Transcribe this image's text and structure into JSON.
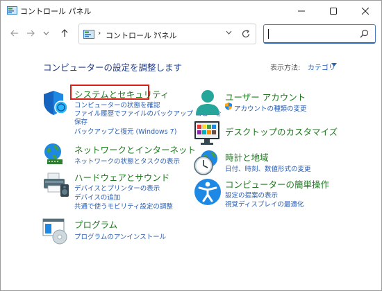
{
  "window": {
    "title": "コントロール パネル",
    "controls": {
      "minimize": "minimize-icon",
      "maximize": "maximize-icon",
      "close": "close-icon"
    }
  },
  "nav": {
    "back": "arrow-left-icon",
    "forward": "arrow-right-icon",
    "recent": "chevron-down-icon",
    "up": "arrow-up-icon",
    "address": {
      "separator": "›",
      "path": "コントロール パネル",
      "trailing_separator": "›"
    },
    "search": {
      "value": "",
      "icon": "search-icon"
    }
  },
  "header": {
    "title": "コンピューターの設定を調整します",
    "view_by_label": "表示方法:",
    "view_by_value": "カテゴリ"
  },
  "categories_left": [
    {
      "title": "システムとセキュリティ",
      "icon": "shield-icon",
      "highlighted": true,
      "links": [
        "コンピューターの状態を確認",
        "ファイル履歴でファイルのバックアップ コピーを",
        "保存",
        "バックアップと復元 (Windows 7)"
      ]
    },
    {
      "title": "ネットワークとインターネット",
      "icon": "network-globe-icon",
      "links": [
        "ネットワークの状態とタスクの表示"
      ]
    },
    {
      "title": "ハードウェアとサウンド",
      "icon": "printer-speaker-icon",
      "links": [
        "デバイスとプリンターの表示",
        "デバイスの追加",
        "共通で使うモビリティ設定の調整"
      ]
    },
    {
      "title": "プログラム",
      "icon": "program-disc-icon",
      "links": [
        "プログラムのアンインストール"
      ]
    }
  ],
  "categories_right": [
    {
      "title": "ユーザー アカウント",
      "icon": "user-icon",
      "links": [
        "アカウントの種類の変更"
      ]
    },
    {
      "title": "デスクトップのカスタマイズ",
      "icon": "desktop-personalize-icon",
      "links": []
    },
    {
      "title": "時計と地域",
      "icon": "clock-globe-icon",
      "links": [
        "日付、時刻、数値形式の変更"
      ]
    },
    {
      "title": "コンピューターの簡単操作",
      "icon": "accessibility-icon",
      "links": [
        "設定の提案の表示",
        "視覚ディスプレイの最適化"
      ]
    }
  ],
  "colors": {
    "category_title": "#1f7a1f",
    "link": "#2a5db0",
    "heading": "#1e3a8a",
    "highlight_border": "#d91e18"
  }
}
